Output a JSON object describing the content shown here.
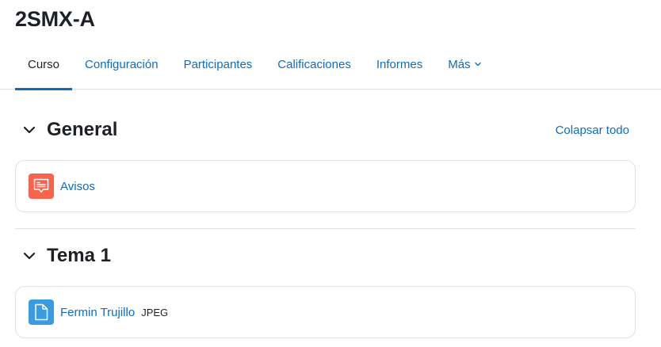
{
  "course": {
    "title": "2SMX-A"
  },
  "tabs": [
    {
      "label": "Curso",
      "active": true
    },
    {
      "label": "Configuración"
    },
    {
      "label": "Participantes"
    },
    {
      "label": "Calificaciones"
    },
    {
      "label": "Informes"
    },
    {
      "label": "Más",
      "icon": "chevron-down-icon"
    }
  ],
  "colors": {
    "link": "#0f6cbf",
    "forum_icon_bg": "#f7634d",
    "file_icon_bg": "#399be2"
  },
  "sections": [
    {
      "title": "General",
      "toggle_icon": "chevron-down-icon",
      "action": "Colapsar todo",
      "activities": [
        {
          "name": "Avisos",
          "icon": "forum-icon"
        }
      ]
    },
    {
      "title": "Tema 1",
      "toggle_icon": "chevron-down-icon",
      "activities": [
        {
          "name": "Fermin Trujillo",
          "type": "JPEG",
          "icon": "file-icon"
        }
      ]
    }
  ]
}
